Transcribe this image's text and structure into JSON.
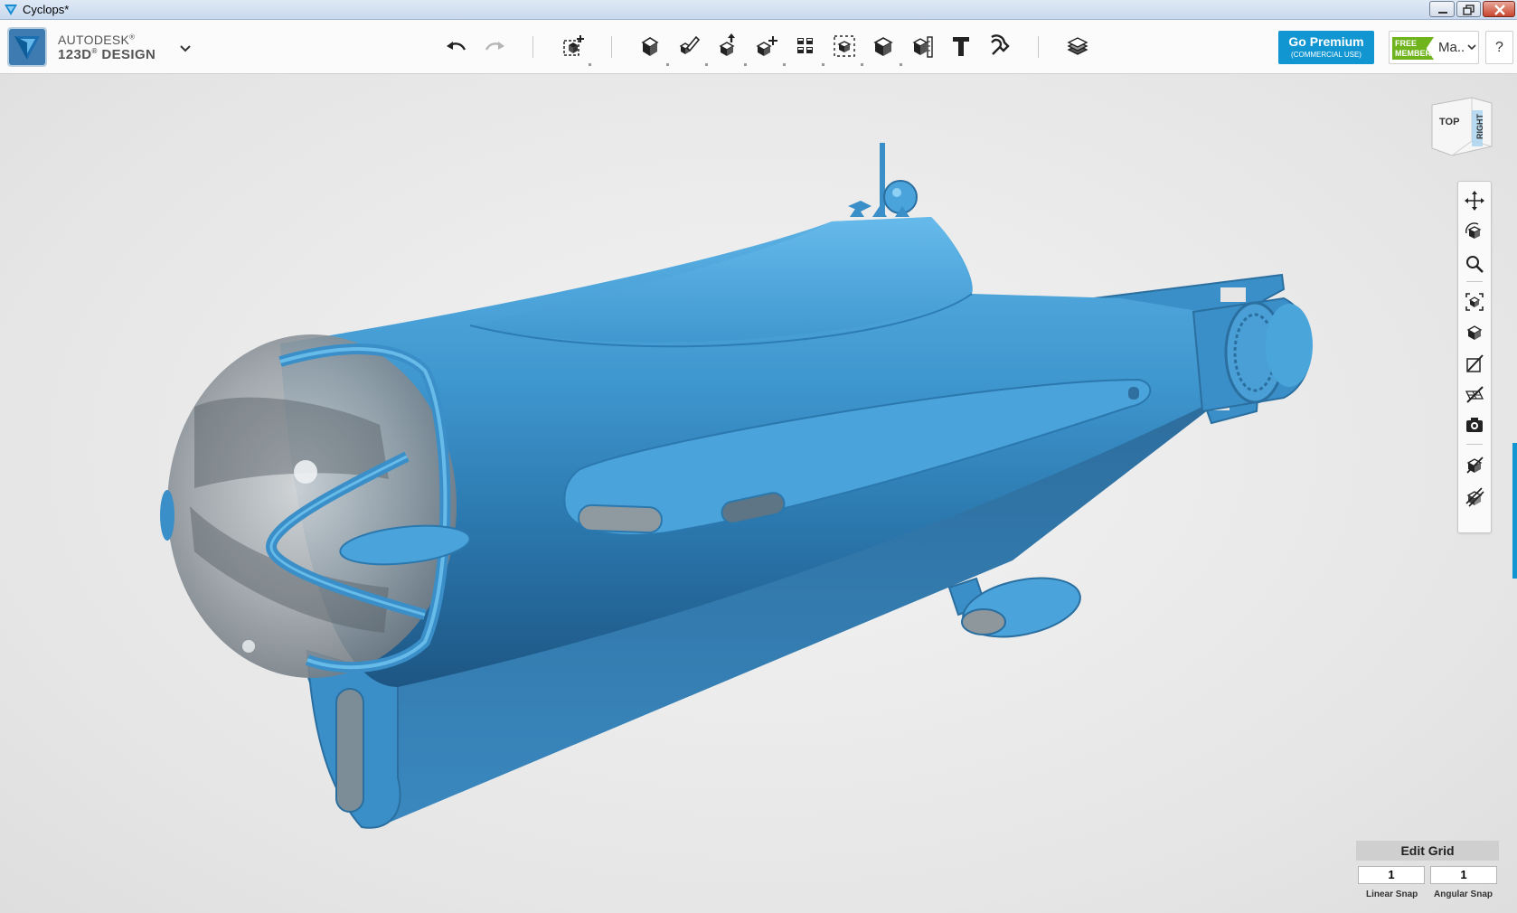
{
  "window": {
    "title": "Cyclops*"
  },
  "brand": {
    "line1": "AUTODESK",
    "line2": "123D",
    "line2_suffix": "DESIGN",
    "registered": "®"
  },
  "toolbar": {
    "items": [
      {
        "name": "undo",
        "icon": "undo-arrow"
      },
      {
        "name": "redo",
        "icon": "redo-arrow"
      },
      {
        "name": "transform",
        "icon": "box-plus"
      },
      {
        "name": "primitives",
        "icon": "box"
      },
      {
        "name": "sketch",
        "icon": "pencil-box"
      },
      {
        "name": "construct",
        "icon": "box-arrow"
      },
      {
        "name": "modify",
        "icon": "box-move"
      },
      {
        "name": "pattern",
        "icon": "grid-boxes"
      },
      {
        "name": "grouping",
        "icon": "box-dashed"
      },
      {
        "name": "combine",
        "icon": "solid-box"
      },
      {
        "name": "measure",
        "icon": "ruler-box"
      },
      {
        "name": "text",
        "icon": "text-T"
      },
      {
        "name": "snap",
        "icon": "magnet"
      },
      {
        "name": "material",
        "icon": "layers"
      }
    ]
  },
  "premium": {
    "label": "Go Premium",
    "sublabel": "(COMMERCIAL USE)",
    "color": "#1196d1"
  },
  "account": {
    "badge_line1": "FREE",
    "badge_line2": "MEMBER",
    "username": "Ma..",
    "badge_color": "#6fb31d"
  },
  "help": {
    "label": "?"
  },
  "viewcube": {
    "top": "TOP",
    "right": "RIGHT"
  },
  "navbar": {
    "items": [
      "pan",
      "orbit",
      "zoom",
      "fit",
      "view-mode",
      "hide-sketch",
      "hide-grid",
      "screenshot",
      "material",
      "hide-all"
    ]
  },
  "edit_grid": {
    "title": "Edit Grid",
    "linear_value": "1",
    "angular_value": "1",
    "linear_label": "Linear Snap",
    "angular_label": "Angular Snap"
  },
  "model": {
    "name": "submarine",
    "color": "#3a8fc8"
  }
}
